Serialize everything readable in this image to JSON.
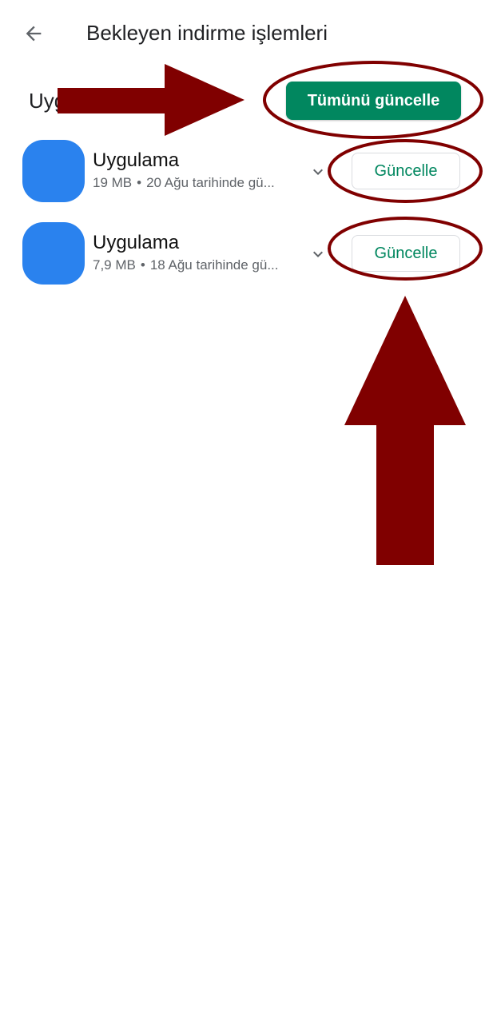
{
  "header": {
    "title": "Bekleyen indirme işlemleri",
    "back_icon": "arrow-left-icon"
  },
  "section": {
    "label": "Uyg",
    "update_all_label": "Tümünü güncelle"
  },
  "apps": [
    {
      "name": "Uygulama",
      "size": "19 MB",
      "separator": "•",
      "date_text": "20 Ağu tarihinde gü...",
      "update_label": "Güncelle",
      "icon_color": "#2a82ee"
    },
    {
      "name": "Uygulama",
      "size": "7,9 MB",
      "separator": "•",
      "date_text": "18 Ağu tarihinde gü...",
      "update_label": "Güncelle",
      "icon_color": "#2a82ee"
    }
  ],
  "colors": {
    "accent_green": "#01875f",
    "annotation_maroon": "#800000",
    "app_icon_blue": "#2a82ee"
  }
}
